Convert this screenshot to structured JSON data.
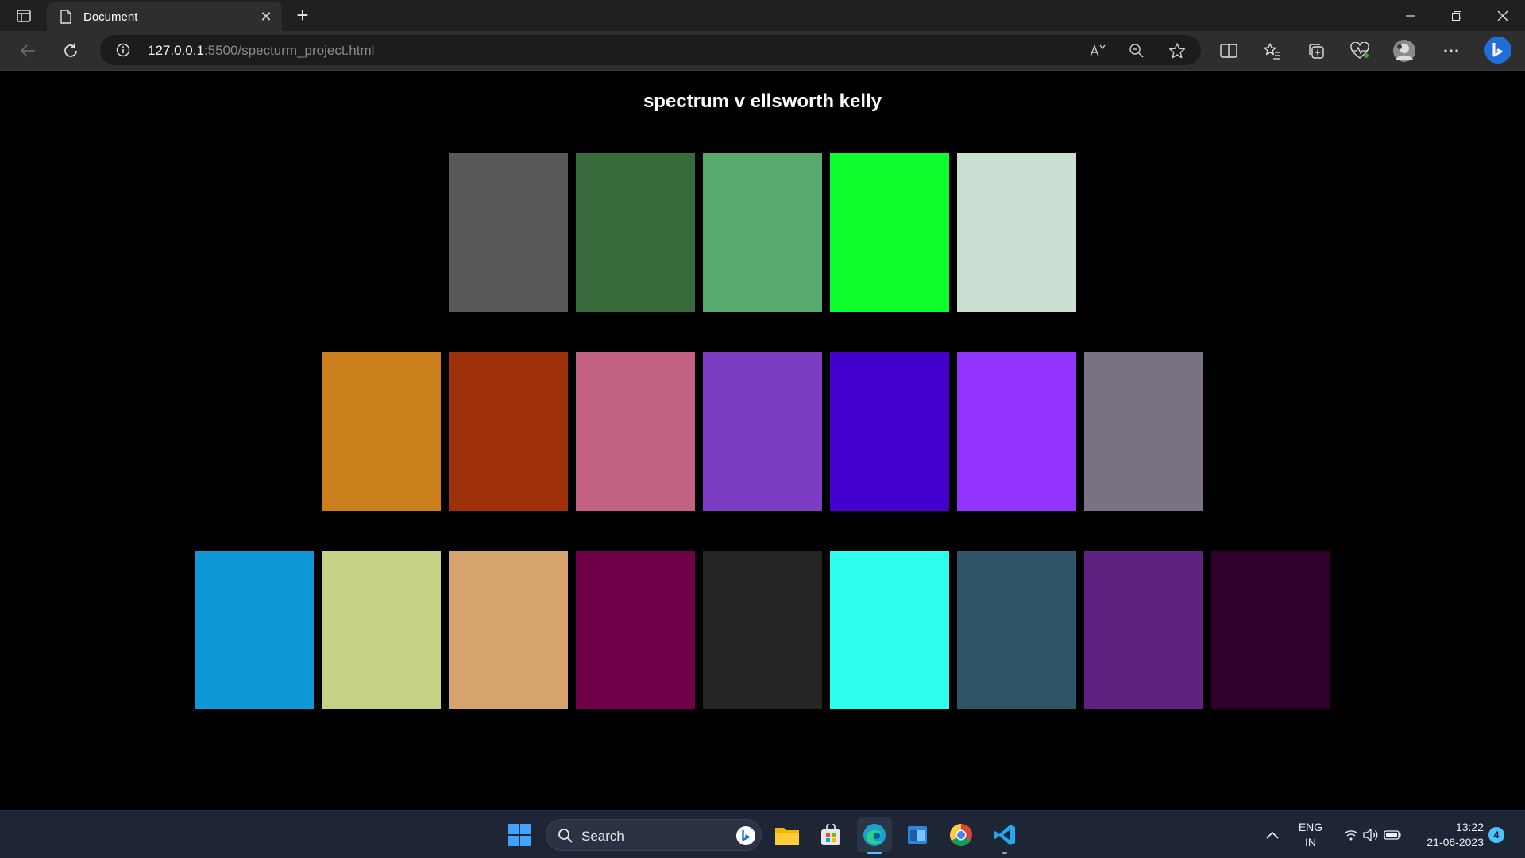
{
  "browser": {
    "tab": {
      "title": "Document"
    },
    "address": {
      "host": "127.0.0.1",
      "path": ":5500/specturm_project.html"
    }
  },
  "page": {
    "title": "spectrum v ellsworth kelly",
    "rows": [
      [
        "#595857",
        "#386b3c",
        "#58a970",
        "#0dfe2d",
        "#c8dfd2"
      ],
      [
        "#cb7e1c",
        "#9e300a",
        "#c36381",
        "#7c3dc3",
        "#4400cd",
        "#9333fe",
        "#7a7182"
      ],
      [
        "#0f98d6",
        "#c4d386",
        "#d4a36e",
        "#6d0046",
        "#252624",
        "#2efeec",
        "#2e5466",
        "#5f2180",
        "#2f0029"
      ]
    ]
  },
  "taskbar": {
    "search_label": "Search",
    "language": {
      "line1": "ENG",
      "line2": "IN"
    },
    "clock": {
      "time": "13:22",
      "date": "21-06-2023"
    },
    "notification_count": "4"
  }
}
